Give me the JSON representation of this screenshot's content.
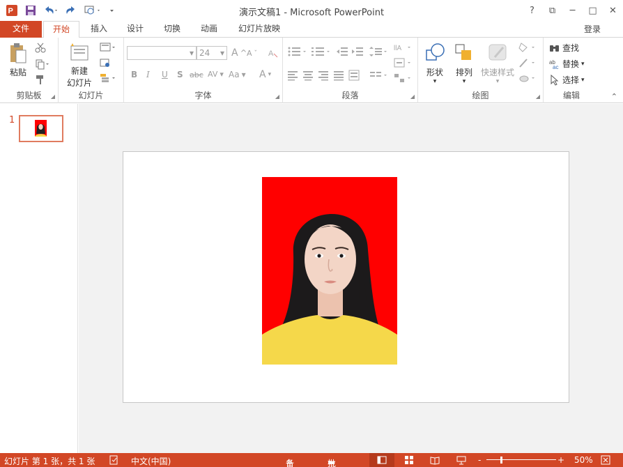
{
  "window": {
    "title": "演示文稿1 - Microsoft PowerPoint",
    "help": "?",
    "restore": "⧉",
    "minimize": "─",
    "maximize": "□",
    "close": "✕"
  },
  "tabs": {
    "file": "文件",
    "home": "开始",
    "insert": "插入",
    "design": "设计",
    "transitions": "切换",
    "animations": "动画",
    "slideshow": "幻灯片放映",
    "signin": "登录"
  },
  "ribbon": {
    "clipboard": {
      "label": "剪贴板",
      "paste": "粘贴"
    },
    "slides": {
      "label": "幻灯片",
      "new_slide_line1": "新建",
      "new_slide_line2": "幻灯片"
    },
    "font": {
      "label": "字体",
      "size": "24",
      "bold": "B",
      "italic": "I",
      "underline": "U",
      "shadow": "S",
      "strike": "abc",
      "spacing": "AV",
      "case": "Aa",
      "color": "A",
      "grow": "A",
      "shrink": "A"
    },
    "paragraph": {
      "label": "段落"
    },
    "drawing": {
      "label": "绘图",
      "shapes": "形状",
      "arrange": "排列",
      "quick_styles": "快速样式"
    },
    "editing": {
      "label": "编辑",
      "find": "查找",
      "replace": "替换",
      "select": "选择"
    }
  },
  "thumbnails": {
    "slide_number": "1"
  },
  "status": {
    "slide_info": "幻灯片 第 1 张，共 1 张",
    "language": "中文(中国)",
    "notes": "备注",
    "comments": "批注",
    "zoom": "50%"
  },
  "colors": {
    "accent": "#d24726",
    "photo_background": "#ff0000",
    "shirt": "#f5d84a"
  }
}
